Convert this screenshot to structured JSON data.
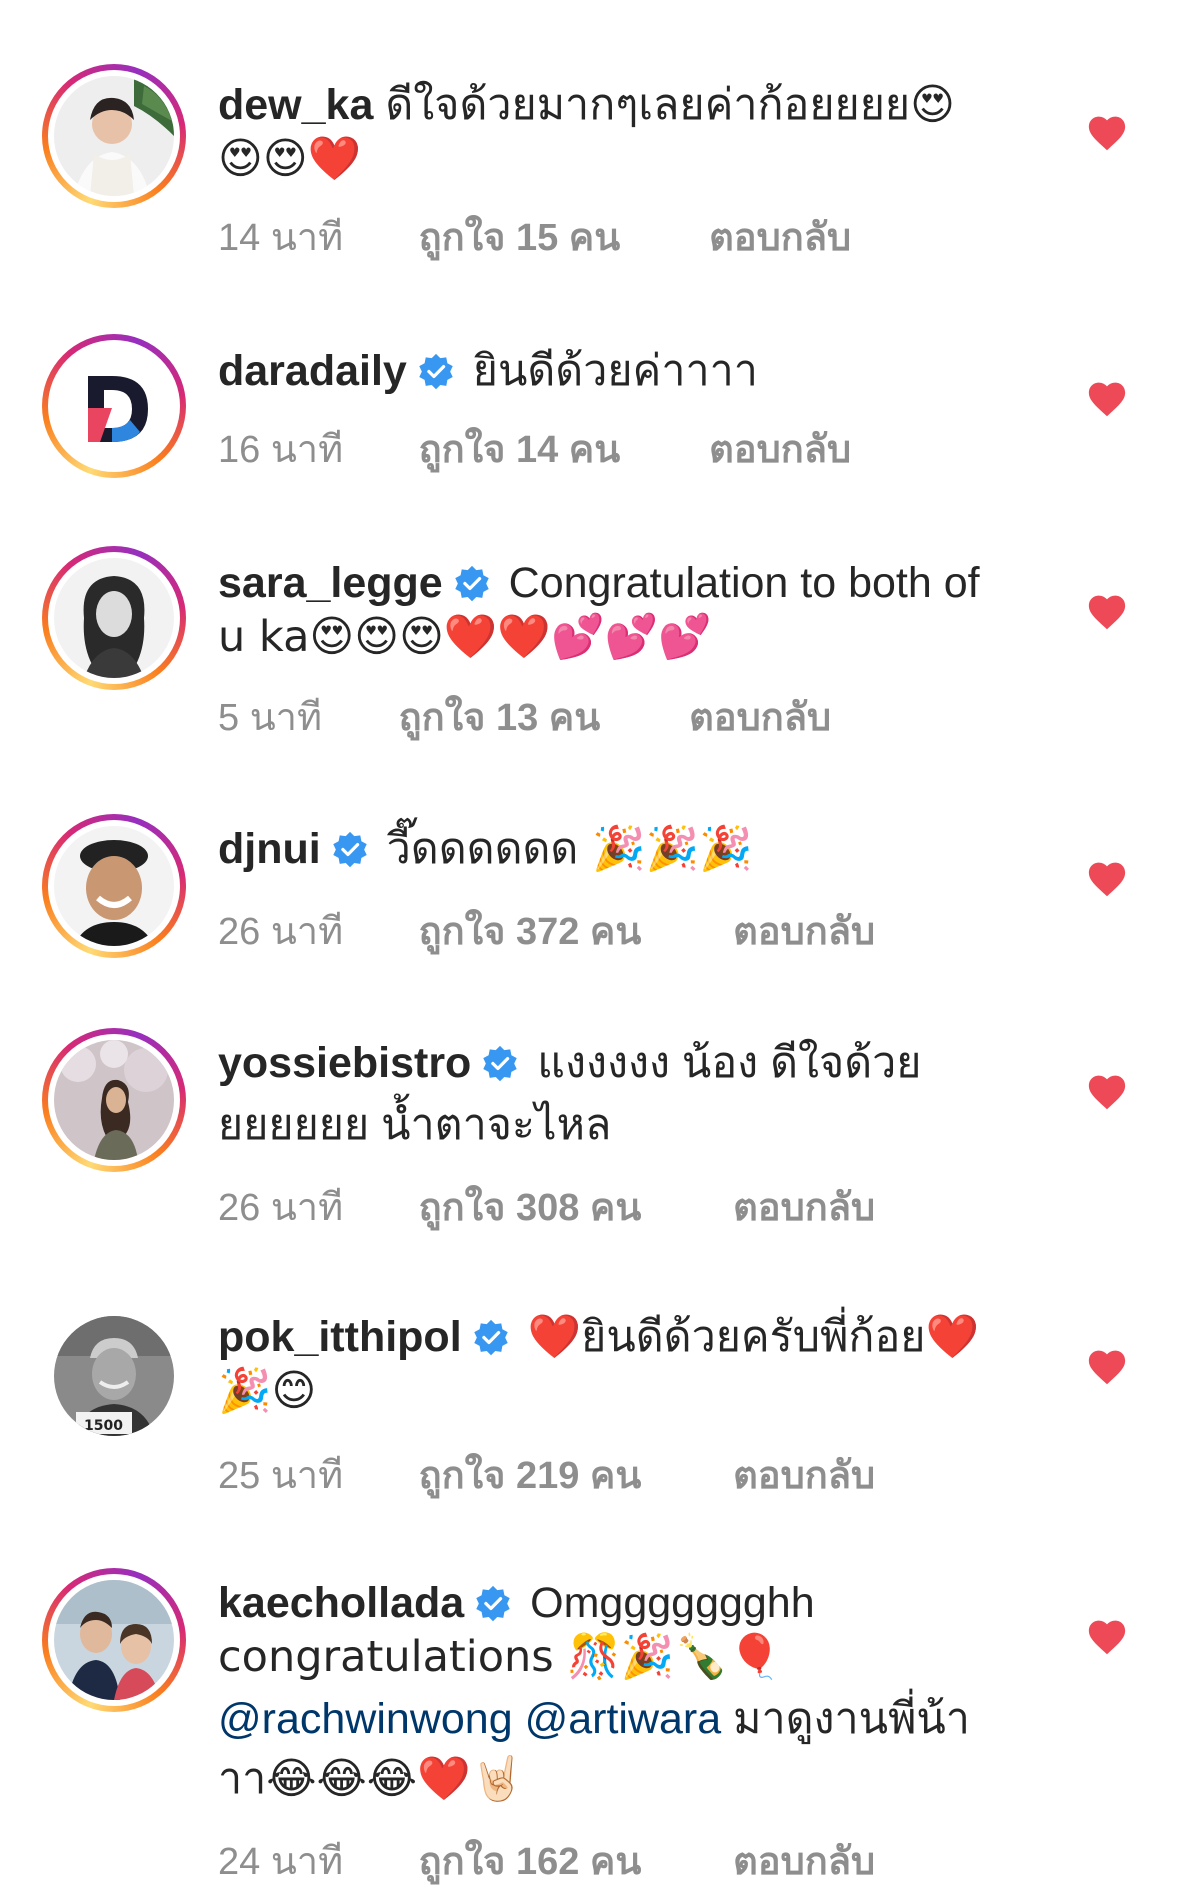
{
  "comments": [
    {
      "username": "dew_ka",
      "verified": false,
      "text1": "ดีใจด้วยมากๆเลยค่าก้อยยยย😍",
      "text2": "😍😍❤️",
      "time": "14 นาที",
      "likes": "ถูกใจ 15 คน",
      "reply": "ตอบกลับ"
    },
    {
      "username": "daradaily",
      "verified": true,
      "text1": "ยินดีด้วยค่าาาา",
      "time": "16 นาที",
      "likes": "ถูกใจ 14 คน",
      "reply": "ตอบกลับ"
    },
    {
      "username": "sara_legge",
      "verified": true,
      "text1": "Congratulation to both of",
      "text2": "u ka😍😍😍❤️❤️💕💕💕",
      "time": "5 นาที",
      "likes": "ถูกใจ 13 คน",
      "reply": "ตอบกลับ"
    },
    {
      "username": "djnui",
      "verified": true,
      "text1": "วี๊ดดดดดด 🎉🎉🎉",
      "time": "26 นาที",
      "likes": "ถูกใจ 372 คน",
      "reply": "ตอบกลับ"
    },
    {
      "username": "yossiebistro",
      "verified": true,
      "text1": "แงงงงง น้อง ดีใจด้วย",
      "text2": "ยยยยยย น้ำตาจะไหล",
      "time": "26 นาที",
      "likes": "ถูกใจ 308 คน",
      "reply": "ตอบกลับ"
    },
    {
      "username": "pok_itthipol",
      "verified": true,
      "text1": "❤️ยินดีด้วยครับพี่ก้อย❤️",
      "text2": "🎉😊",
      "time": "25 นาที",
      "likes": "ถูกใจ 219 คน",
      "reply": "ตอบกลับ"
    },
    {
      "username": "kaechollada",
      "verified": true,
      "text1": "Omggggggghh",
      "text2": "congratulations 🎊🎉🍾🎈",
      "mention1": "@rachwinwong",
      "mention2": "@artiwara",
      "text3": " มาดูงานพี่น้า",
      "text4": "าา😂😂😂❤️🤘🏻",
      "time": "24 นาที",
      "likes": "ถูกใจ 162 คน",
      "reply": "ตอบกลับ"
    }
  ],
  "colors": {
    "heart": "#ed4956",
    "verified": "#3897f0",
    "meta": "#8e8e8e",
    "mention": "#00376b"
  },
  "icons": {
    "like": "heart-icon",
    "verified": "verified-badge-icon"
  }
}
